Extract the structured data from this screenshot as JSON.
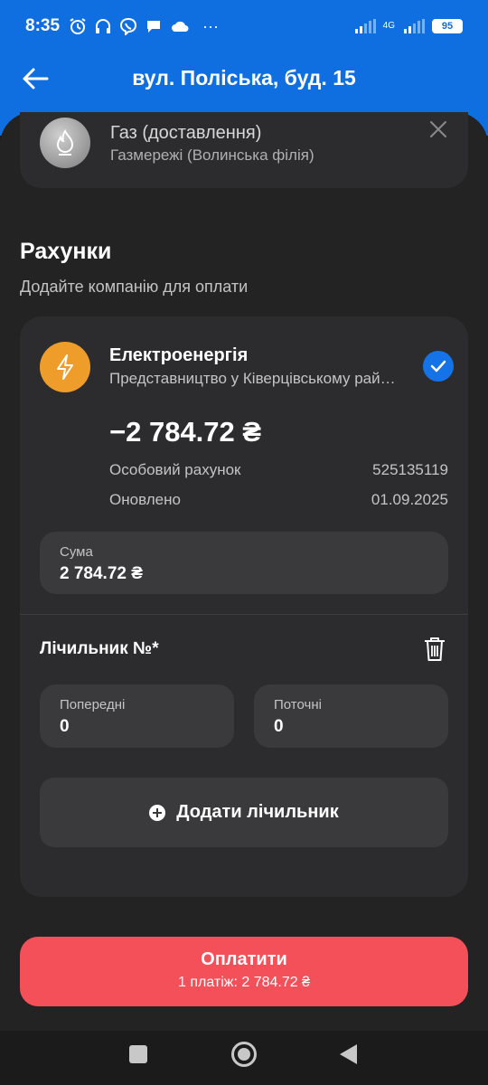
{
  "status_bar": {
    "time": "8:35",
    "status_icons": [
      "alarm-icon",
      "headphones-icon",
      "viber-icon",
      "chat-icon",
      "cloud-icon"
    ],
    "more": "···",
    "network": "4G",
    "battery": "95"
  },
  "header": {
    "title": "вул. Поліська, буд. 15"
  },
  "gas_service": {
    "title": "Газ (доставлення)",
    "subtitle": "Газмережі (Волинська філія)"
  },
  "bills_section": {
    "title": "Рахунки",
    "subtitle": "Додайте компанію для оплати"
  },
  "bill": {
    "title": "Електроенергія",
    "subtitle": "Представництво у Ківерцівському районі",
    "balance": "−2 784.72 ₴",
    "account_label": "Особовий рахунок",
    "account_value": "525135119",
    "updated_label": "Оновлено",
    "updated_value": "01.09.2025",
    "sum_label": "Сума",
    "sum_value": "2 784.72 ₴",
    "selected": true
  },
  "meter": {
    "title": "Лічильник №*",
    "previous_label": "Попередні",
    "previous_value": "0",
    "current_label": "Поточні",
    "current_value": "0",
    "add_label": "Додати лічильник"
  },
  "pay": {
    "title": "Оплатити",
    "subtitle": "1 платіж: 2 784.72 ₴"
  },
  "colors": {
    "primary": "#0f6fe0",
    "pay_button": "#f4505a",
    "electricity_icon": "#ef9d2a",
    "check": "#1473e6"
  }
}
